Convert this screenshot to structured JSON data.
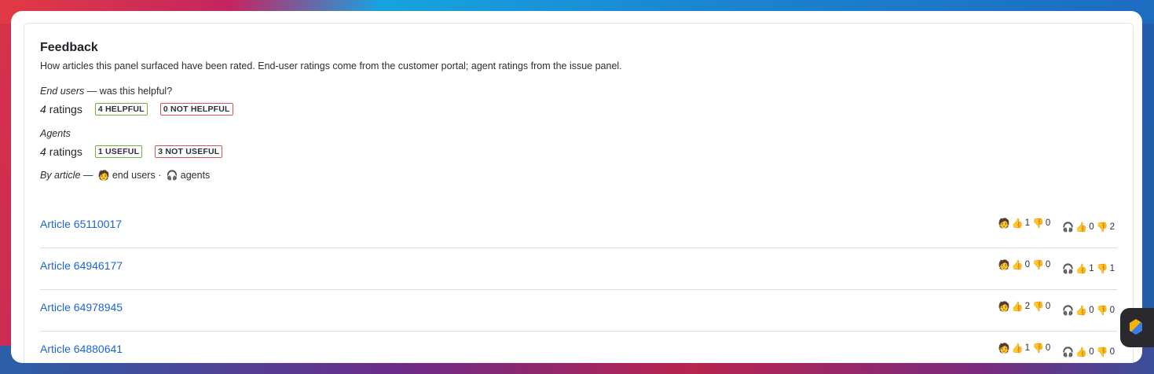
{
  "panel": {
    "title": "Feedback",
    "description": "How articles this panel surfaced have been rated. End-user ratings come from the customer portal; agent ratings from the issue panel."
  },
  "end_users": {
    "label_em": "End users",
    "label_rest": " — was this helpful?",
    "count": "4",
    "unit": "ratings",
    "positive_badge": "4 HELPFUL",
    "negative_badge": "0 NOT HELPFUL"
  },
  "agents": {
    "label_em": "Agents",
    "count": "4",
    "unit": "ratings",
    "positive_badge": "1 USEFUL",
    "negative_badge": "3 NOT USEFUL"
  },
  "by_article": {
    "label_em": "By article",
    "sep": " — ",
    "end_users_emoji": "🧑",
    "end_users_text": "end users",
    "dot": " · ",
    "agents_emoji": "🎧",
    "agents_text": "agents"
  },
  "icons": {
    "end_user": "🧑",
    "agent": "🎧",
    "thumbs_up": "👍",
    "thumbs_down": "👎"
  },
  "articles": [
    {
      "title": "Article 65110017",
      "end_up": "1",
      "end_down": "0",
      "agent_up": "0",
      "agent_down": "2"
    },
    {
      "title": "Article 64946177",
      "end_up": "0",
      "end_down": "0",
      "agent_up": "1",
      "agent_down": "1"
    },
    {
      "title": "Article 64978945",
      "end_up": "2",
      "end_down": "0",
      "agent_up": "0",
      "agent_down": "0"
    },
    {
      "title": "Article 64880641",
      "end_up": "1",
      "end_down": "0",
      "agent_up": "0",
      "agent_down": "0"
    }
  ]
}
